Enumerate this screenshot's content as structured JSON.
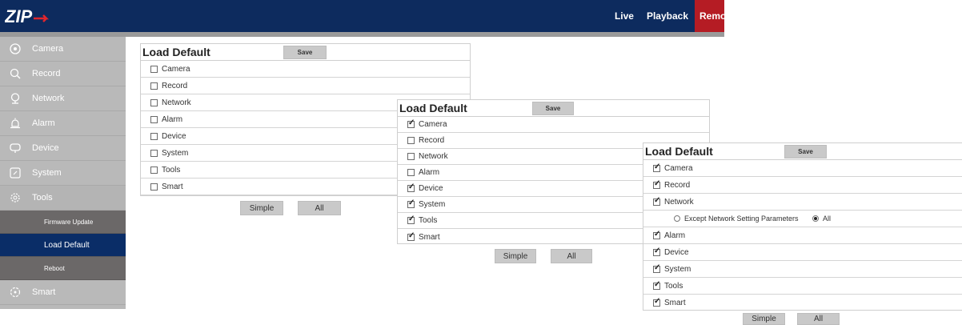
{
  "topbar": {
    "logo_text": "ZIP",
    "nav": [
      {
        "label": "Live"
      },
      {
        "label": "Playback"
      },
      {
        "label": "Remo"
      }
    ],
    "colors": {
      "bar": "#0d2b5e",
      "active": "#b51c24"
    }
  },
  "sidebar": {
    "items": [
      {
        "label": "Camera",
        "icon": "camera-icon"
      },
      {
        "label": "Record",
        "icon": "search-icon"
      },
      {
        "label": "Network",
        "icon": "network-icon"
      },
      {
        "label": "Alarm",
        "icon": "alarm-icon"
      },
      {
        "label": "Device",
        "icon": "monitor-icon"
      },
      {
        "label": "System",
        "icon": "system-icon"
      },
      {
        "label": "Tools",
        "icon": "gear-icon"
      }
    ],
    "tools_sub": [
      {
        "label": "Firmware Update"
      },
      {
        "label": "Load Default"
      },
      {
        "label": "Reboot"
      }
    ],
    "after": [
      {
        "label": "Smart",
        "icon": "smart-icon"
      }
    ]
  },
  "panel1": {
    "title": "Load Default",
    "save_label": "Save",
    "rows": [
      {
        "label": "Camera",
        "checked": false
      },
      {
        "label": "Record",
        "checked": false
      },
      {
        "label": "Network",
        "checked": false
      },
      {
        "label": "Alarm",
        "checked": false
      },
      {
        "label": "Device",
        "checked": false
      },
      {
        "label": "System",
        "checked": false
      },
      {
        "label": "Tools",
        "checked": false
      },
      {
        "label": "Smart",
        "checked": false
      }
    ],
    "simple_label": "Simple",
    "all_label": "All"
  },
  "panel2": {
    "title": "Load Default",
    "save_label": "Save",
    "rows": [
      {
        "label": "Camera",
        "checked": true
      },
      {
        "label": "Record",
        "checked": false
      },
      {
        "label": "Network",
        "checked": false
      },
      {
        "label": "Alarm",
        "checked": false
      },
      {
        "label": "Device",
        "checked": true
      },
      {
        "label": "System",
        "checked": true
      },
      {
        "label": "Tools",
        "checked": true
      },
      {
        "label": "Smart",
        "checked": true
      }
    ],
    "simple_label": "Simple",
    "all_label": "All"
  },
  "panel3": {
    "title": "Load Default",
    "save_label": "Save",
    "rows_top": [
      {
        "label": "Camera",
        "checked": true
      },
      {
        "label": "Record",
        "checked": true
      },
      {
        "label": "Network",
        "checked": true
      }
    ],
    "network_options": {
      "except_label": "Except Network Setting Parameters",
      "all_label": "All",
      "selected": "All"
    },
    "rows_bottom": [
      {
        "label": "Alarm",
        "checked": true
      },
      {
        "label": "Device",
        "checked": true
      },
      {
        "label": "System",
        "checked": true
      },
      {
        "label": "Tools",
        "checked": true
      },
      {
        "label": "Smart",
        "checked": true
      }
    ],
    "simple_label": "Simple",
    "all_label": "All"
  }
}
